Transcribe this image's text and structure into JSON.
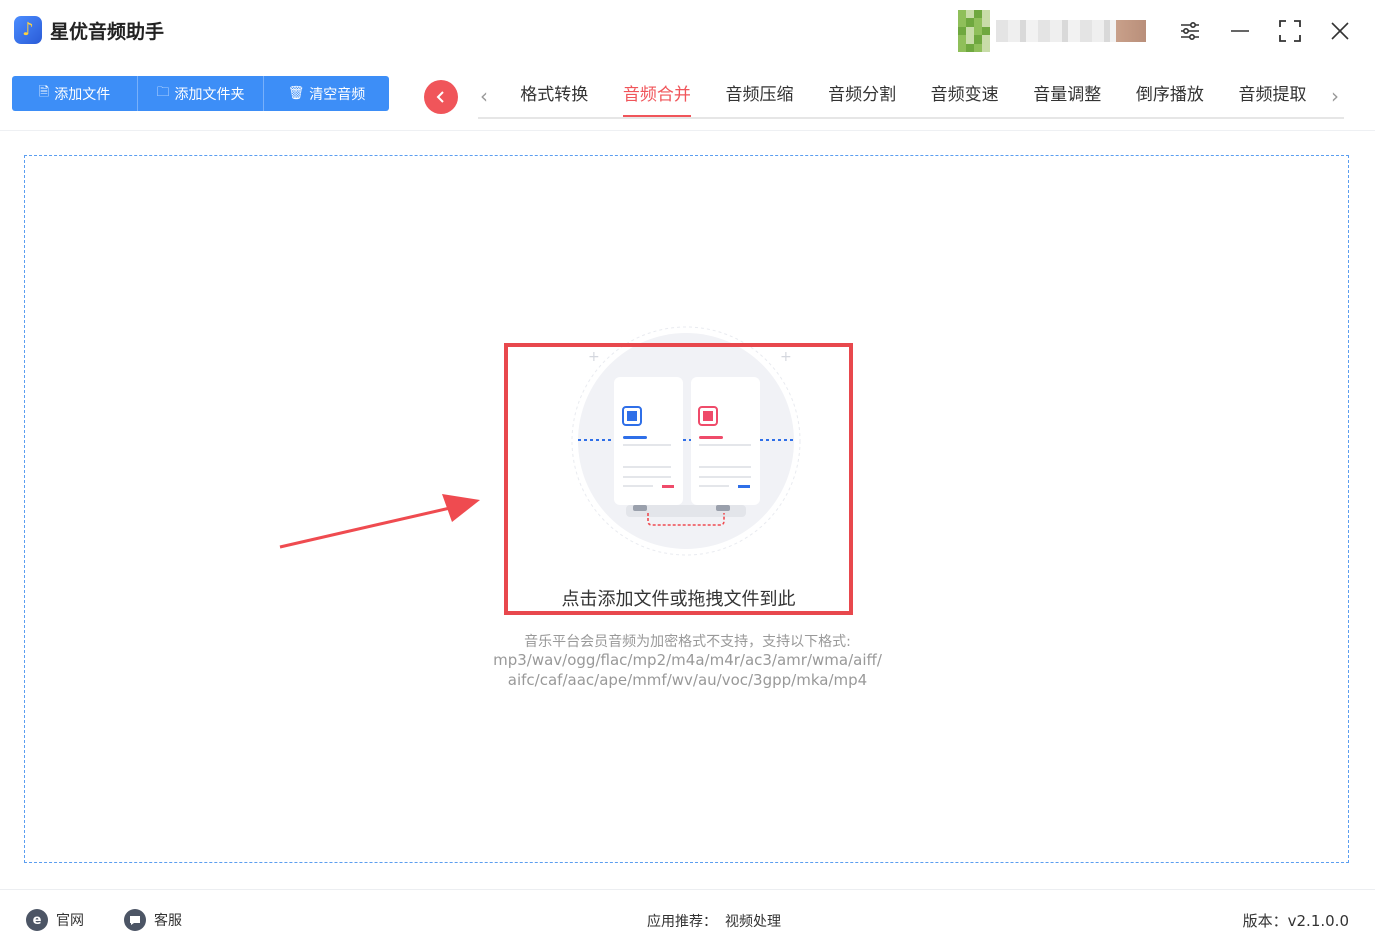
{
  "app": {
    "title": "星优音频助手",
    "logo_glyph": "♪"
  },
  "window": {
    "settings_glyph": "⚟",
    "minimize_glyph": "—",
    "maximize_glyph": "⛶",
    "close_glyph": "✕"
  },
  "toolbar": {
    "add_file": "添加文件",
    "add_folder": "添加文件夹",
    "clear": "清空音频"
  },
  "tabs": [
    "格式转换",
    "音频合并",
    "音频压缩",
    "音频分割",
    "音频变速",
    "音量调整",
    "倒序播放",
    "音频提取"
  ],
  "active_tab": 1,
  "drop": {
    "label": "点击添加文件或拖拽文件到此",
    "hint_line1": "音乐平台会员音频为加密格式不支持，支持以下格式:",
    "hint_line2": "mp3/wav/ogg/flac/mp2/m4a/m4r/ac3/amr/wma/aiff/",
    "hint_line3": "aifc/caf/aac/ape/mmf/wv/au/voc/3gpp/mka/mp4"
  },
  "footer": {
    "website": "官网",
    "support": "客服",
    "recommend_label": "应用推荐：",
    "recommend_link": "视频处理",
    "version": "版本：v2.1.0.0"
  },
  "colors": {
    "accent": "#f0555a",
    "primary": "#3d8ef7",
    "highlight_box": "#e8484d"
  }
}
